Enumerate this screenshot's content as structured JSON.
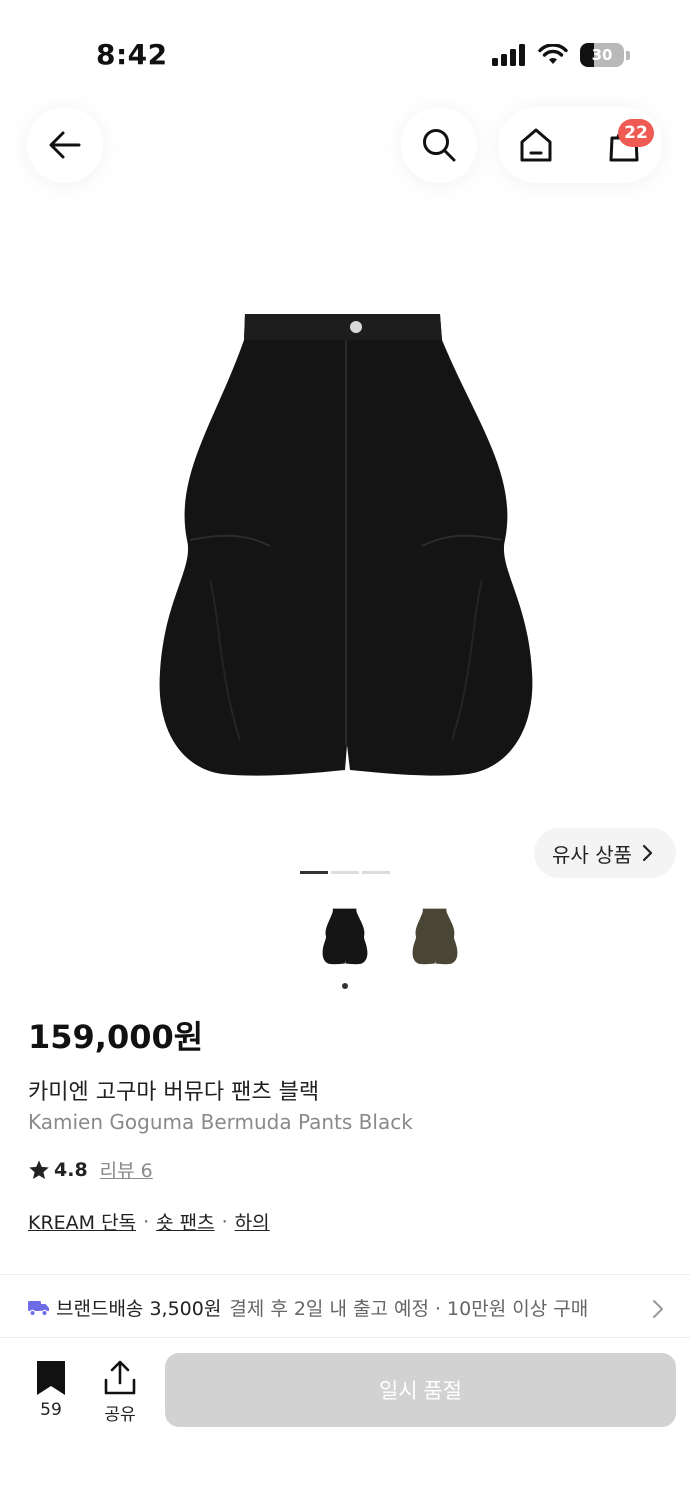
{
  "status_bar": {
    "time": "8:42",
    "battery": "30"
  },
  "nav": {
    "cart_count": "22"
  },
  "gallery": {
    "similar_label": "유사 상품",
    "indicator_count": 3,
    "active_index": 0
  },
  "product": {
    "price": "159,000원",
    "name_ko": "카미엔 고구마 버뮤다 팬츠 블랙",
    "name_en": "Kamien Goguma Bermuda Pants Black",
    "rating": "4.8",
    "review_label": "리뷰 6",
    "tags": [
      "KREAM 단독",
      "숏 팬츠",
      "하의"
    ],
    "tag_separator": "·"
  },
  "delivery": {
    "label": "브랜드배송 3,500원",
    "info": "결제 후 2일 내 출고 예정 · 10만원 이상 구매"
  },
  "bottom_bar": {
    "bookmark_count": "59",
    "share_label": "공유",
    "soldout_label": "일시 품절"
  },
  "colors": {
    "badge": "#ef5a52",
    "delivery_icon": "#6d6ce6",
    "soldout_bg": "#d2d2d2"
  }
}
